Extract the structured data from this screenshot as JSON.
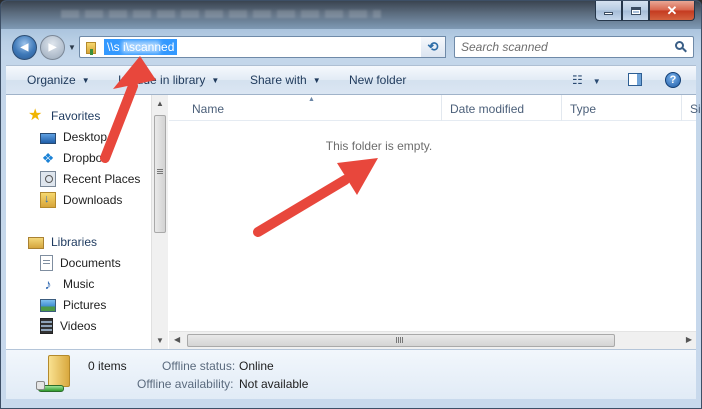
{
  "window": {
    "minimize_glyph": "",
    "maximize_glyph": "",
    "close_glyph": "✕"
  },
  "navigation": {
    "back_glyph": "◀",
    "forward_glyph": "▶",
    "address_path": "\\\\s          i\\scanned",
    "refresh_glyph": "⟲"
  },
  "search": {
    "placeholder": "Search scanned"
  },
  "toolbar": {
    "organize": "Organize",
    "include_in_library": "Include in library",
    "share_with": "Share with",
    "new_folder": "New folder",
    "views_glyph": "☷",
    "help_glyph": "?"
  },
  "sidebar": {
    "favorites": {
      "label": "Favorites",
      "items": [
        {
          "label": "Desktop",
          "icon": "desktop-icon"
        },
        {
          "label": "Dropbox",
          "icon": "dropbox-icon"
        },
        {
          "label": "Recent Places",
          "icon": "recent-places-icon"
        },
        {
          "label": "Downloads",
          "icon": "downloads-icon"
        }
      ]
    },
    "libraries": {
      "label": "Libraries",
      "items": [
        {
          "label": "Documents",
          "icon": "documents-icon"
        },
        {
          "label": "Music",
          "icon": "music-icon"
        },
        {
          "label": "Pictures",
          "icon": "pictures-icon"
        },
        {
          "label": "Videos",
          "icon": "videos-icon"
        }
      ]
    }
  },
  "file_list": {
    "columns": [
      "Name",
      "Date modified",
      "Type",
      "Si"
    ],
    "empty_message": "This folder is empty."
  },
  "details": {
    "item_count": "0 items",
    "offline_status_label": "Offline status:",
    "offline_status_value": "Online",
    "offline_availability_label": "Offline availability:",
    "offline_availability_value": "Not available"
  },
  "colors": {
    "annotation_arrow": "#e8473c",
    "selection": "#3399ff",
    "command_text": "#1e395b"
  }
}
